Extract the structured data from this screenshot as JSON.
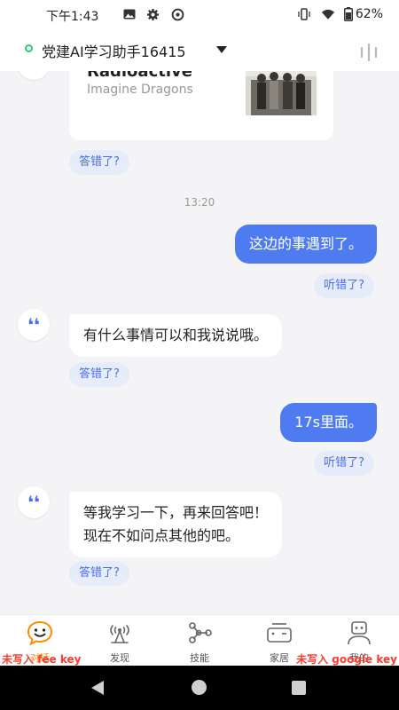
{
  "status_bar": {
    "time": "下午1:43",
    "battery_percent": "62%",
    "icons": [
      "image-icon",
      "settings-gear-icon",
      "do-not-disturb-icon",
      "vibrate-icon",
      "wifi-icon",
      "battery-icon"
    ]
  },
  "header": {
    "title": "党建AI学习助手16415",
    "status_color": "#2ecc71",
    "icons": [
      "online-status-icon",
      "dropdown-caret-icon",
      "voice-bars-icon"
    ]
  },
  "chat": {
    "music_card": {
      "title": "Radioactive",
      "artist": "Imagine Dragons",
      "icons": [
        "album-art-image"
      ]
    },
    "feedback_answer_wrong": "答错了?",
    "feedback_heard_wrong": "听错了?",
    "timestamp": "13:20",
    "messages": [
      {
        "from": "user",
        "text": "这边的事遇到了。"
      },
      {
        "from": "assistant",
        "text": "有什么事情可以和我说说哦。"
      },
      {
        "from": "user",
        "text": "17s里面。"
      },
      {
        "from": "assistant",
        "lines": [
          "等我学习一下，再来回答吧！",
          "现在不如问点其他的吧。"
        ]
      }
    ],
    "avatar_icon": "quote-mark-icon",
    "colors": {
      "user_bubble": "#4f7bf0",
      "feedback_pill_bg": "#e7ecfb",
      "feedback_pill_text": "#4a6fe8"
    }
  },
  "bottom_nav": {
    "items": [
      {
        "label": "对话",
        "icon": "smiley-chat-icon",
        "active": true
      },
      {
        "label": "发现",
        "icon": "radar-discover-icon"
      },
      {
        "label": "技能",
        "icon": "skill-nodes-icon"
      },
      {
        "label": "家居",
        "icon": "smart-home-device-icon"
      },
      {
        "label": "我的",
        "icon": "robot-profile-icon"
      }
    ],
    "active_color": "#ff8a00"
  },
  "watermarks": {
    "left": "未写入 fee key",
    "right": "未写入 google key"
  },
  "system_nav": {
    "icons": [
      "back-triangle-icon",
      "home-circle-icon",
      "recents-square-icon"
    ]
  }
}
